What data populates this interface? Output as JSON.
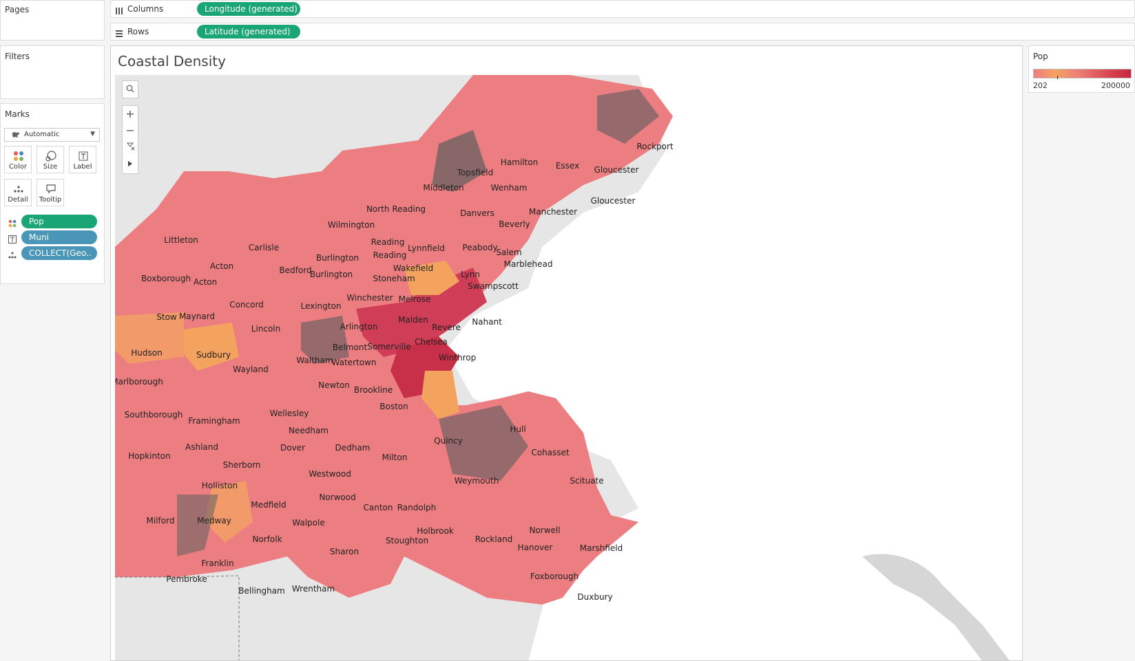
{
  "panels": {
    "pages_title": "Pages",
    "filters_title": "Filters",
    "marks_title": "Marks"
  },
  "shelves": {
    "columns_label": "Columns",
    "columns_pill": "Longitude (generated)",
    "rows_label": "Rows",
    "rows_pill": "Latitude (generated)"
  },
  "marks": {
    "type": "Automatic",
    "buttons": [
      "Color",
      "Size",
      "Label",
      "Detail",
      "Tooltip"
    ],
    "fields": [
      {
        "icon": "color-icon",
        "label": "Pop",
        "color": "#1aa576"
      },
      {
        "icon": "text-icon",
        "label": "Muni",
        "color": "#4a96b8"
      },
      {
        "icon": "detail-icon",
        "label": "COLLECT(Geo..",
        "color": "#4a96b8"
      }
    ]
  },
  "view": {
    "title": "Coastal Density"
  },
  "legend": {
    "title": "Pop",
    "min": "202",
    "max": "200000"
  },
  "colors": {
    "low": "#f07c84",
    "mid": "#f4a35f",
    "high": "#c5283e",
    "shelf_pill": "#1aa576",
    "field_pill": "#4a96b8"
  },
  "towns": [
    "Rockport",
    "Hamilton",
    "Essex",
    "Gloucester",
    "Topsfield",
    "Wenham",
    "Middleton",
    "Gloucester",
    "Manchester",
    "Danvers",
    "North Reading",
    "Beverly",
    "Wilmington",
    "Littleton",
    "Carlisle",
    "Reading",
    "Lynnfield",
    "Peabody",
    "Salem",
    "Burlington",
    "Reading",
    "Acton",
    "Bedford",
    "Burlington",
    "Wakefield",
    "Marblehead",
    "Boxborough",
    "Acton",
    "Stoneham",
    "Lynn",
    "Swampscott",
    "Winchester",
    "Concord",
    "Lexington",
    "Melrose",
    "Stow",
    "Maynard",
    "Lincoln",
    "Arlington",
    "Malden",
    "Revere",
    "Nahant",
    "Belmont",
    "Somerville",
    "Chelsea",
    "Hudson",
    "Sudbury",
    "Waltham",
    "Watertown",
    "Winthrop",
    "Wayland",
    "Marlborough",
    "Newton",
    "Brookline",
    "Boston",
    "Wellesley",
    "Southborough",
    "Framingham",
    "Needham",
    "Hull",
    "Ashland",
    "Dover",
    "Dedham",
    "Quincy",
    "Hopkinton",
    "Cohasset",
    "Milton",
    "Sherborn",
    "Westwood",
    "Weymouth",
    "Scituate",
    "Holliston",
    "Norwood",
    "Medfield",
    "Canton",
    "Randolph",
    "Milford",
    "Medway",
    "Walpole",
    "Holbrook",
    "Norwell",
    "Rockland",
    "Norfolk",
    "Hanover",
    "Marshfield",
    "Stoughton",
    "Sharon",
    "Franklin",
    "Pembroke",
    "Bellingham",
    "Wrentham",
    "Foxborough",
    "Duxbury"
  ]
}
